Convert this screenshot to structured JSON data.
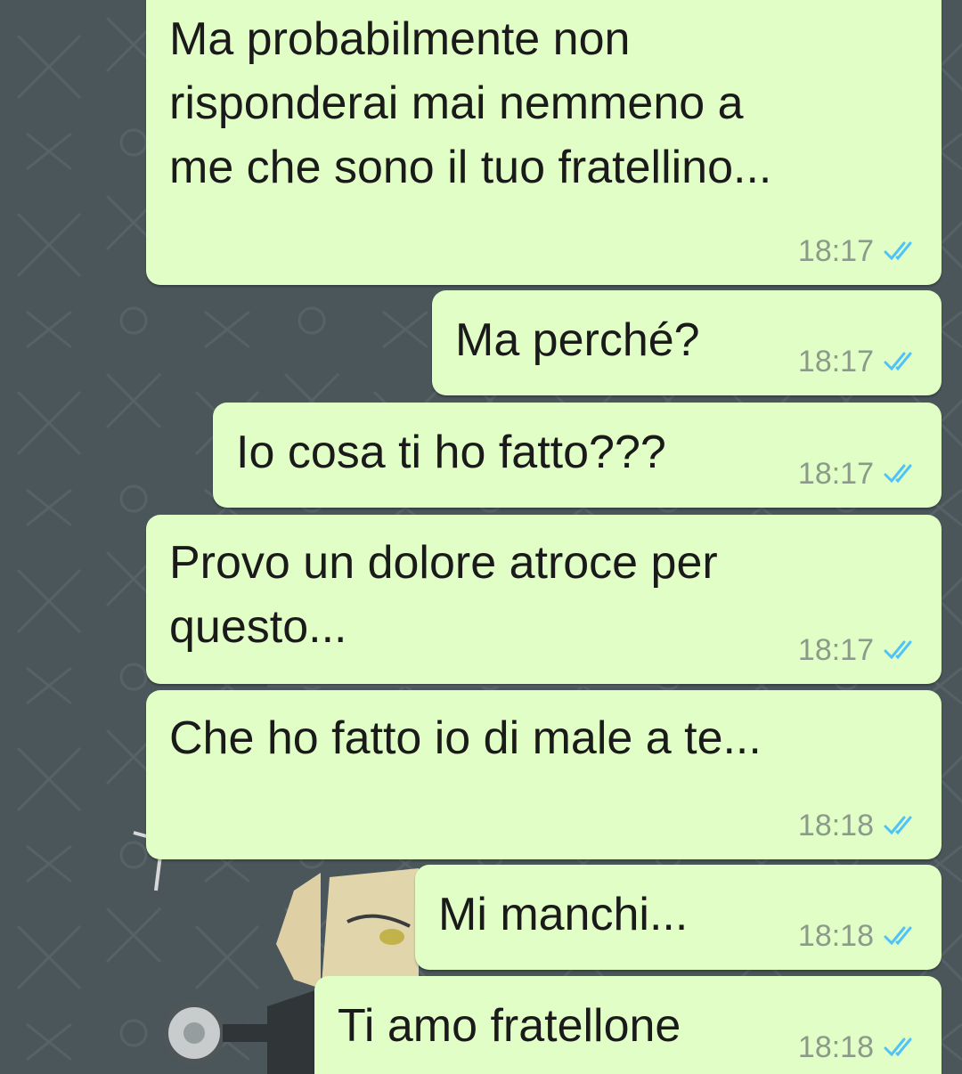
{
  "chat": {
    "colors": {
      "outgoing_bubble": "#e1fec6",
      "wallpaper": "#4a565a",
      "read_ticks": "#4fc3f7",
      "timestamp": "#8c9a8a"
    },
    "messages": [
      {
        "text": "Ma probabilmente non\nrisponderai mai nemmeno a\nme che sono il tuo fratellino...",
        "time": "18:17",
        "status": "read"
      },
      {
        "text": "Ma perché?",
        "time": "18:17",
        "status": "read"
      },
      {
        "text": "Io cosa ti ho fatto???",
        "time": "18:17",
        "status": "read"
      },
      {
        "text": "Provo un dolore atroce per\nquesto...",
        "time": "18:17",
        "status": "read"
      },
      {
        "text": "Che ho fatto io di male a te...",
        "time": "18:18",
        "status": "read"
      },
      {
        "text": "Mi manchi...",
        "time": "18:18",
        "status": "read"
      },
      {
        "text": "Ti amo fratellone",
        "time": "18:18",
        "status": "read"
      }
    ]
  }
}
